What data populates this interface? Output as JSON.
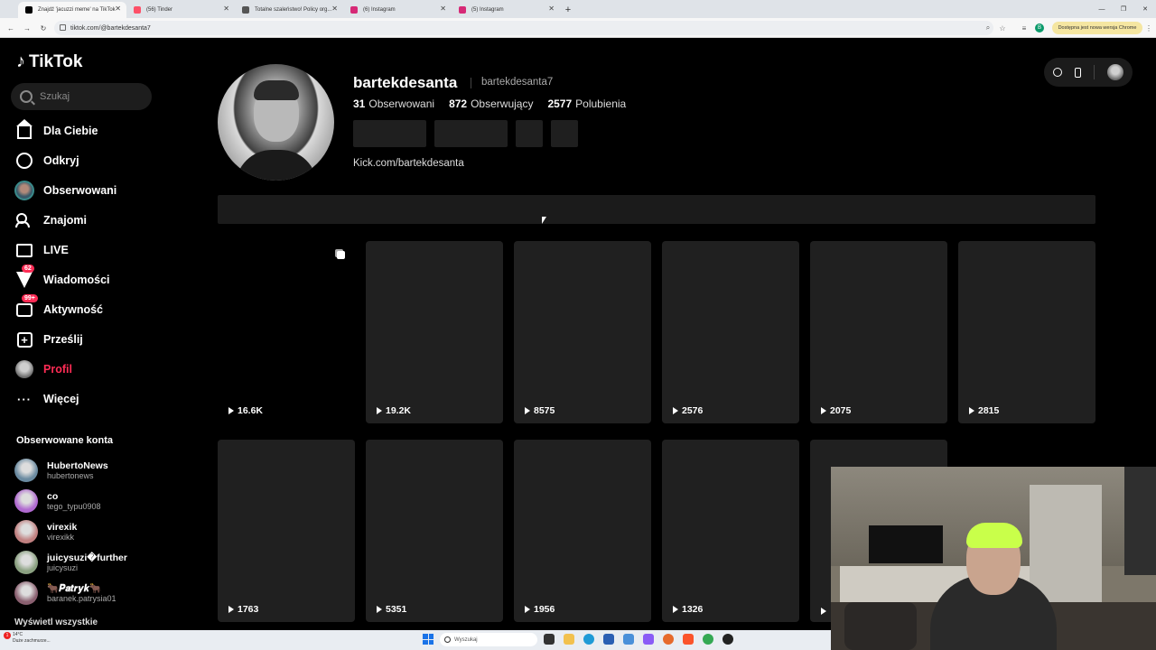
{
  "browser": {
    "tabs": [
      {
        "label": "Znajdź 'jacuzzi meme' na TikTok",
        "favicon_color": "#000000",
        "active": true
      },
      {
        "label": "(56) Tinder",
        "favicon_color": "#fd5068",
        "active": false
      },
      {
        "label": "Totalne szaleństwo! Policy org...",
        "favicon_color": "#555555",
        "active": false
      },
      {
        "label": "(6) Instagram",
        "favicon_color": "#d62976",
        "active": false
      },
      {
        "label": "(5) Instagram",
        "favicon_color": "#d62976",
        "active": false
      }
    ],
    "url": "tiktok.com/@bartekdesanta7",
    "update_notice": "Dostępna jest nowa wersja Chrome"
  },
  "sidebar": {
    "logo": "TikTok",
    "search_placeholder": "Szukaj",
    "menu": [
      {
        "label": "Dla Ciebie",
        "icon": "home-icon",
        "badge": ""
      },
      {
        "label": "Odkryj",
        "icon": "compass-icon",
        "badge": ""
      },
      {
        "label": "Obserwowani",
        "icon": "following-avatar-icon",
        "badge": ""
      },
      {
        "label": "Znajomi",
        "icon": "friends-icon",
        "badge": ""
      },
      {
        "label": "LIVE",
        "icon": "live-icon",
        "badge": ""
      },
      {
        "label": "Wiadomości",
        "icon": "messages-icon",
        "badge": "62"
      },
      {
        "label": "Aktywność",
        "icon": "activity-icon",
        "badge": "99+"
      },
      {
        "label": "Prześlij",
        "icon": "upload-icon",
        "badge": ""
      },
      {
        "label": "Profil",
        "icon": "profile-avatar-icon",
        "badge": ""
      },
      {
        "label": "Więcej",
        "icon": "more-icon",
        "badge": ""
      }
    ],
    "followed_title": "Obserwowane konta",
    "followed_accounts": [
      {
        "name": "HubertoNews",
        "handle": "hubertonews",
        "avatar_color": "#6a8aa0"
      },
      {
        "name": "co",
        "handle": "tego_typu0908",
        "avatar_color": "#b06ad0"
      },
      {
        "name": "virexik",
        "handle": "virexikk",
        "avatar_color": "#c08080"
      },
      {
        "name": "juicysuzi�further",
        "handle": "juicysuzi",
        "avatar_color": "#8aa080"
      },
      {
        "name": "🐂𝑷𝒂𝒕𝒓𝒚𝒌🐂",
        "handle": "baranek.patrysia01",
        "avatar_color": "#8a6070"
      }
    ],
    "show_all": "Wyświetl wszystkie"
  },
  "profile": {
    "username": "bartekdesanta",
    "nickname": "bartekdesanta7",
    "following_count": "31",
    "following_label": "Obserwowani",
    "followers_count": "872",
    "followers_label": "Obserwujący",
    "likes_count": "2577",
    "likes_label": "Polubienia",
    "bio_link": "Kick.com/bartekdesanta"
  },
  "videos": {
    "row1": [
      "16.6K",
      "19.2K",
      "8575",
      "2576",
      "2075",
      "2815"
    ],
    "row2": [
      "1763",
      "5351",
      "1956",
      "1326",
      ""
    ]
  },
  "taskbar": {
    "weather_temp": "14°C",
    "weather_desc": "Duże zachmurze...",
    "search_placeholder": "Wyszukaj"
  }
}
